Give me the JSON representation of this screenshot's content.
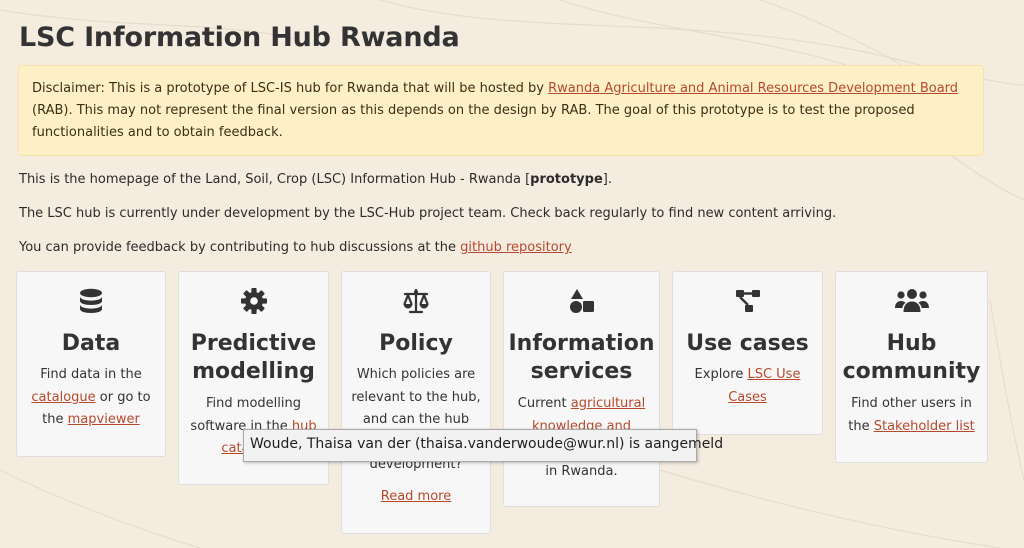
{
  "page": {
    "title": "LSC Information Hub Rwanda",
    "colors": {
      "background": "#f5ece0",
      "link": "#b6492d",
      "disclaimer_bg": "#fdf0c7"
    }
  },
  "disclaimer": {
    "text_before": "Disclaimer: This is a prototype of LSC-IS hub for Rwanda that will be hosted by ",
    "link_text": "Rwanda Agriculture and Animal Resources Development Board",
    "text_after": " (RAB). This may not represent the final version as this depends on the design by RAB. The goal of this prototype is to test the proposed functionalities and to obtain feedback."
  },
  "intro": {
    "p1_before": "This is the homepage of the Land, Soil, Crop (LSC) Information Hub - Rwanda [",
    "p1_bold": "prototype",
    "p1_after": "].",
    "p2": "The LSC hub is currently under development by the LSC-Hub project team. Check back regularly to find new content arriving.",
    "p3_before": "You can provide feedback by contributing to hub discussions at the ",
    "p3_link": "github repository"
  },
  "cards": {
    "data": {
      "icon": "database-icon",
      "title": "Data",
      "t1": "Find data in the ",
      "link1": "catalogue",
      "t2": " or go to the ",
      "link2": "mapviewer"
    },
    "modelling": {
      "icon": "gear-icon",
      "title": "Predictive modelling",
      "t1": "Find modelling software in the ",
      "link1": "hub catalogue"
    },
    "policy": {
      "icon": "scale-balance-icon",
      "title": "Policy",
      "t1": "Which policies are relevant to the hub, and can the hub support policy development?",
      "readmore": "Read more"
    },
    "info": {
      "icon": "shapes-icon",
      "title": "Information services",
      "t1": "Current ",
      "link1": "agricultural knowledge and information services",
      "t2": " in Rwanda."
    },
    "usecases": {
      "icon": "diagram-project-icon",
      "title": "Use cases",
      "t1": "Explore ",
      "link1": "LSC Use Cases"
    },
    "community": {
      "icon": "users-icon",
      "title": "Hub community",
      "t1": "Find other users in the ",
      "link1": "Stakeholder list"
    }
  },
  "tooltip": {
    "text": "Woude, Thaisa van der (thaisa.vanderwoude@wur.nl) is aangemeld"
  }
}
